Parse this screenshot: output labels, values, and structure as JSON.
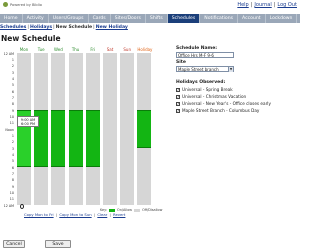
{
  "brand": {
    "powered_by": "Powered by Biblio"
  },
  "top_links": [
    "Help",
    "Journal",
    "Log Out"
  ],
  "nav": {
    "tabs": [
      "Home",
      "Activity",
      "Users/Groups",
      "Cards",
      "Sites/Doors",
      "Shifts",
      "Schedules",
      "Notifications",
      "Account",
      "Lockdown"
    ],
    "active_tab": "Schedules"
  },
  "subnav": [
    "Schedules",
    "Holidays",
    "New Schedule",
    "New Holiday"
  ],
  "page_title": "New Schedule",
  "grid": {
    "days": [
      "Mon",
      "Tue",
      "Wed",
      "Thu",
      "Fri",
      "Sat",
      "Sun",
      "Holiday"
    ],
    "time_labels": [
      "12 AM",
      "1",
      "2",
      "3",
      "4",
      "5",
      "6",
      "7",
      "8",
      "9",
      "10",
      "11",
      "Noon",
      "1",
      "2",
      "3",
      "4",
      "5",
      "6",
      "7",
      "8",
      "9",
      "10",
      "11",
      "12 AM"
    ],
    "tooltip": {
      "start": "9:00 AM",
      "end": "6:00 PM"
    },
    "blocks": [
      {
        "day": "Mon",
        "start": 9,
        "end": 18,
        "selected": true
      },
      {
        "day": "Tue",
        "start": 9,
        "end": 18
      },
      {
        "day": "Wed",
        "start": 9,
        "end": 18
      },
      {
        "day": "Thu",
        "start": 9,
        "end": 18
      },
      {
        "day": "Fri",
        "start": 9,
        "end": 18
      },
      {
        "day": "Holiday",
        "start": 9,
        "end": 15
      }
    ],
    "links": [
      "Copy Mon to Fri",
      "Copy Mon to Sun",
      "Clear",
      "Revert"
    ],
    "legend": {
      "key": "Key:",
      "on": "On/Allow",
      "off": "Off/Disallow"
    },
    "colors": {
      "on": "#13b513",
      "off": "#d6d6d6",
      "day_color": "#2a8a2a",
      "weekend_color": "#c0392b",
      "holiday_color": "#e06010"
    }
  },
  "form": {
    "name_label": "Schedule Name:",
    "name_value": "Office Hrs M-F 9-6",
    "site_label": "Site",
    "site_value": "Maple Street branch",
    "holidays_label": "Holidays Observed:",
    "holidays": [
      {
        "label": "Universal - Spring Break",
        "checked": true
      },
      {
        "label": "Universal - Christmas Vacation",
        "checked": true
      },
      {
        "label": "Universal - New Year's - Office closes early",
        "checked": true
      },
      {
        "label": "Maple Street Branch - Columbus Day",
        "checked": true
      }
    ]
  },
  "buttons": {
    "cancel": "Cancel",
    "save": "Save"
  }
}
